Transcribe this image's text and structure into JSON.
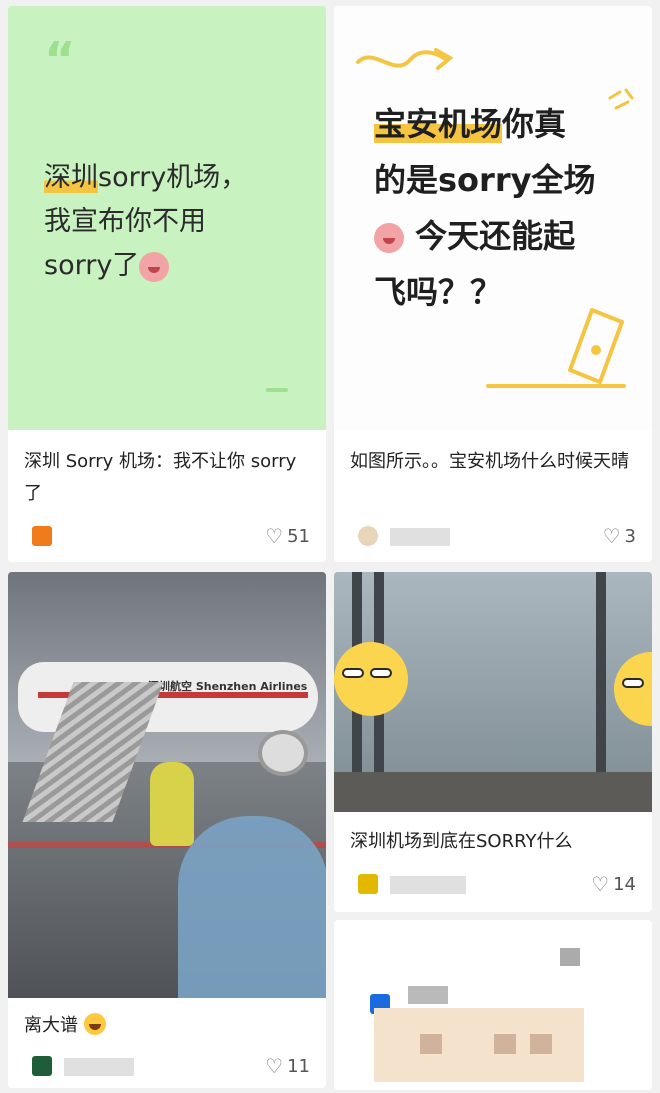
{
  "cards": [
    {
      "cover_text_lines": [
        "深圳sorry机场，",
        "我宣布你不用",
        "sorry了"
      ],
      "cover_highlight": "深圳",
      "quote_mark": "“",
      "title": "深圳 Sorry 机场：我不让你 sorry 了",
      "avatar_color": "#f07b1a",
      "likes": "51"
    },
    {
      "cover_text_lines": [
        "宝安机场你真",
        "的是sorry全场",
        "今天还能起",
        "飞吗？？"
      ],
      "cover_highlight": "宝安机场",
      "title": "如图所示。。宝安机场什么时候天晴",
      "avatar_color": "#e8d4b8",
      "likes": "3"
    },
    {
      "cover_airline": "Shenzhen Airlines",
      "cover_airline_cn": "深圳航空",
      "title": "离大谱",
      "avatar_color": "#1f5d3a",
      "likes": "11"
    },
    {
      "title": "深圳机场到底在SORRY什么",
      "avatar_color": "#e2b800",
      "likes": "14"
    }
  ],
  "colors": {
    "green_cover": "#c8f2c0",
    "highlight": "#f5c542"
  },
  "icons": [
    "heart-icon",
    "quote-icon",
    "pen-icon",
    "arrow-doodle-icon",
    "smiley-icon"
  ]
}
